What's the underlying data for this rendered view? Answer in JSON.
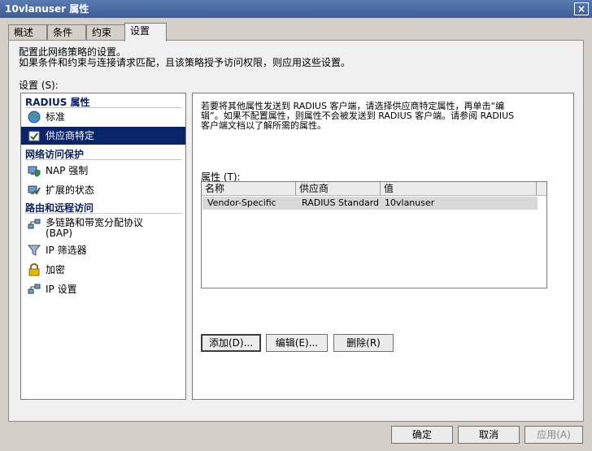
{
  "window": {
    "title": "10vlanuser 属性",
    "close_glyph": "×"
  },
  "tabs": [
    {
      "label": "概述"
    },
    {
      "label": "条件"
    },
    {
      "label": "约束"
    },
    {
      "label": "设置"
    }
  ],
  "description": {
    "line1": "配置此网络策略的设置。",
    "line2": "如果条件和约束与连接请求匹配，且该策略授予访问权限，则应用这些设置。"
  },
  "settings_label": "设置 (S):",
  "groups": {
    "radius": "RADIUS 属性",
    "nap": "网络访问保护",
    "routing": "路由和远程访问"
  },
  "items": {
    "standard": "标准",
    "vendor_specific": "供应商特定",
    "nap_enforce": "NAP 强制",
    "extended_state": "扩展的状态",
    "multilink_line1": "多链路和带宽分配协议",
    "multilink_line2": "(BAP)",
    "ip_filters": "IP 筛选器",
    "encryption": "加密",
    "ip_settings": "IP 设置"
  },
  "icons": {
    "standard": "globe-icon",
    "vendor_specific": "checkbox-icon",
    "nap_enforce": "shield-computer-icon",
    "extended_state": "state-icon",
    "multilink": "network-icon",
    "ip_filters": "funnel-icon",
    "encryption": "lock-icon",
    "ip_settings": "network-icon"
  },
  "right": {
    "desc_line1": "若要将其他属性发送到 RADIUS 客户端，请选择供应商特定属性，再单击“编",
    "desc_line2": "辑”。如果不配置属性，则属性不会被发送到 RADIUS 客户端。请参阅 RADIUS",
    "desc_line3": "客户端文档以了解所需的属性。",
    "attributes_label": "属性 (T):",
    "columns": [
      "名称",
      "供应商",
      "值"
    ],
    "rows": [
      {
        "name": "Vendor-Specific",
        "vendor": "RADIUS Standard",
        "value": "10vlanuser"
      }
    ],
    "add_button": "添加(D)...",
    "edit_button": "编辑(E)...",
    "delete_button": "删除(R)"
  },
  "footer": {
    "ok": "确定",
    "cancel": "取消",
    "apply": "应用(A)"
  }
}
